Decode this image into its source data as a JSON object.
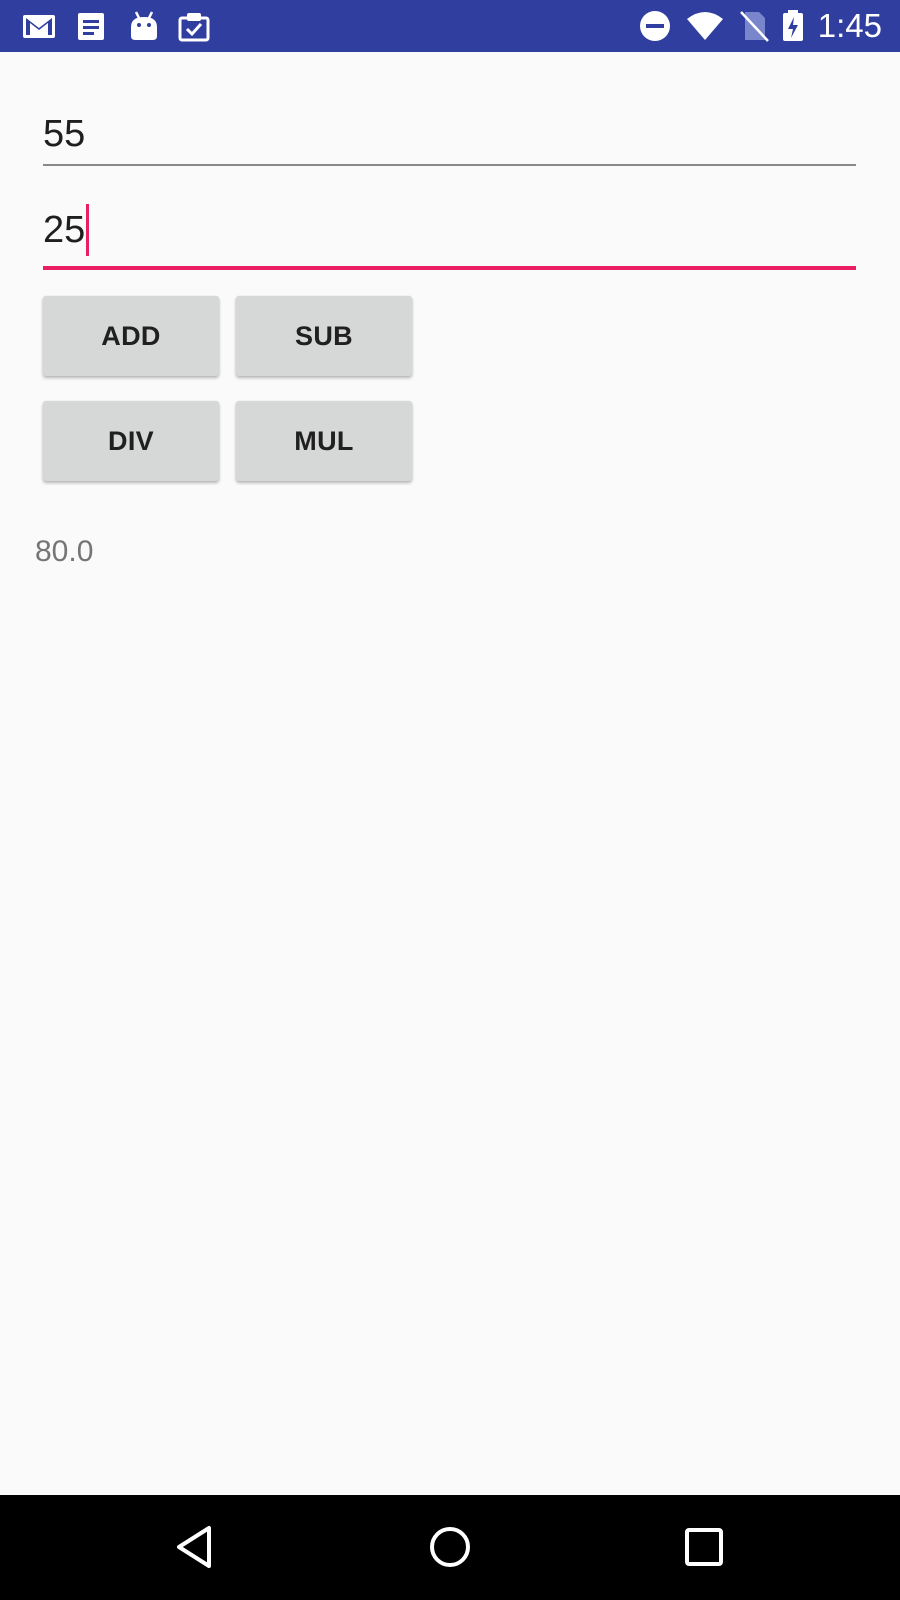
{
  "status_bar": {
    "time": "1:45",
    "notification_icons": [
      "gmail-icon",
      "document-icon",
      "android-icon",
      "clipboard-check-icon"
    ],
    "system_icons": [
      "do-not-disturb-icon",
      "wifi-icon",
      "no-sim-icon",
      "battery-charging-icon"
    ],
    "background_color": "#303f9f"
  },
  "form": {
    "first_number": "55",
    "second_number": "25",
    "accent_color": "#e91e63"
  },
  "buttons": {
    "add": "ADD",
    "sub": "SUB",
    "div": "DIV",
    "mul": "MUL"
  },
  "result": {
    "value": "80.0"
  },
  "nav_bar": {
    "buttons": [
      "back-icon",
      "home-icon",
      "recents-icon"
    ]
  }
}
